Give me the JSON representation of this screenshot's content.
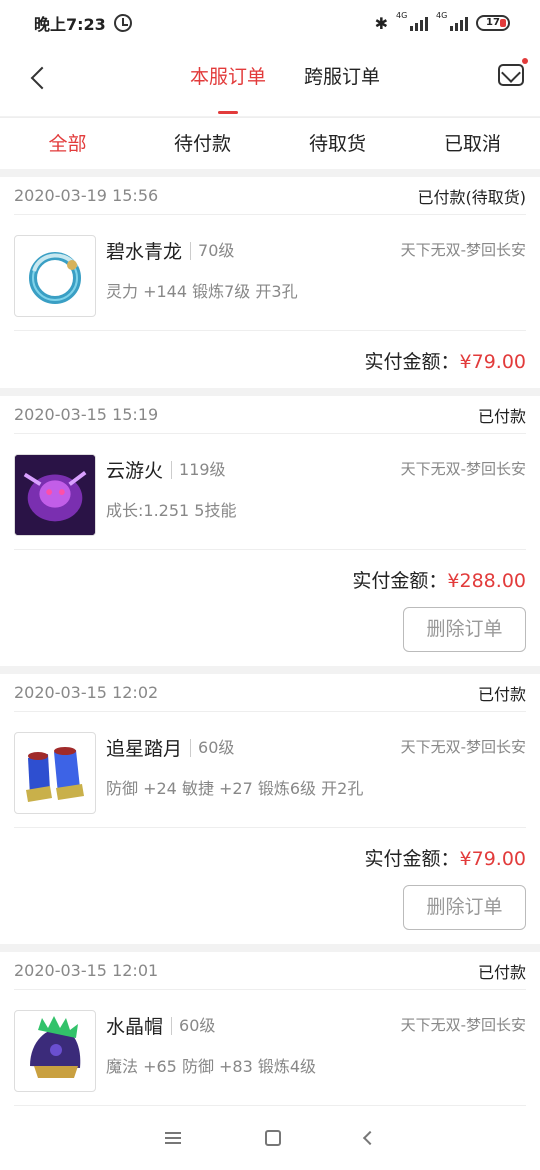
{
  "status_bar": {
    "time": "晚上7:23",
    "bluetooth": "✱",
    "net1": "4G",
    "net2": "4G",
    "battery": "17"
  },
  "header": {
    "tabs": [
      {
        "label": "本服订单",
        "active": true
      },
      {
        "label": "跨服订单",
        "active": false
      }
    ]
  },
  "filters": [
    {
      "label": "全部",
      "active": true
    },
    {
      "label": "待付款",
      "active": false
    },
    {
      "label": "待取货",
      "active": false
    },
    {
      "label": "已取消",
      "active": false
    }
  ],
  "orders": [
    {
      "date": "2020-03-19 15:56",
      "status": "已付款(待取货)",
      "name": "碧水青龙",
      "level": "70级",
      "server": "天下无双-梦回长安",
      "attrs": "灵力 +144 锻炼7级 开3孔",
      "pay_label": "实付金额：",
      "amount": "¥79.00",
      "delete": ""
    },
    {
      "date": "2020-03-15 15:19",
      "status": "已付款",
      "name": "云游火",
      "level": "119级",
      "server": "天下无双-梦回长安",
      "attrs": "成长:1.251 5技能",
      "pay_label": "实付金额：",
      "amount": "¥288.00",
      "delete": "删除订单"
    },
    {
      "date": "2020-03-15 12:02",
      "status": "已付款",
      "name": "追星踏月",
      "level": "60级",
      "server": "天下无双-梦回长安",
      "attrs": "防御 +24 敏捷 +27 锻炼6级 开2孔",
      "pay_label": "实付金额：",
      "amount": "¥79.00",
      "delete": "删除订单"
    },
    {
      "date": "2020-03-15 12:01",
      "status": "已付款",
      "name": "水晶帽",
      "level": "60级",
      "server": "天下无双-梦回长安",
      "attrs": "魔法 +65 防御 +83 锻炼4级",
      "pay_label": "",
      "amount": "",
      "delete": ""
    }
  ],
  "colors": {
    "accent": "#e23b3b",
    "muted": "#888888",
    "background": "#f2f2f2"
  }
}
